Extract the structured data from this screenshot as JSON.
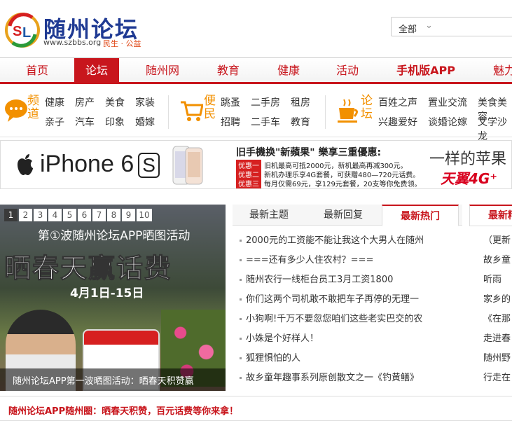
{
  "colors": {
    "brand_red": "#c8161d",
    "orange": "#f29000",
    "dark": "#333333"
  },
  "header": {
    "logo_title": "随州论坛",
    "logo_url": "www.szbbs.org",
    "logo_slogan": "民生 · 公益",
    "search_scope": "全部"
  },
  "nav": {
    "items": [
      "首页",
      "论坛",
      "随州网",
      "教育",
      "健康",
      "活动",
      "手机版APP",
      "魅力"
    ],
    "active": "论坛"
  },
  "channels": [
    {
      "tag": "频道",
      "icon": "chat-bubble-icon",
      "links": [
        [
          "健康",
          "房产",
          "美食",
          "家装"
        ],
        [
          "亲子",
          "汽车",
          "印象",
          "婚嫁"
        ]
      ]
    },
    {
      "tag": "便民",
      "icon": "shopping-cart-icon",
      "links": [
        [
          "跳蚤",
          "二手房",
          "租房"
        ],
        [
          "招聘",
          "二手车",
          "教育"
        ]
      ]
    },
    {
      "tag": "论坛",
      "icon": "coffee-cup-icon",
      "links": [
        [
          "百姓之声",
          "置业交流",
          "美食美容"
        ],
        [
          "兴趣爱好",
          "谈婚论嫁",
          "文学沙龙"
        ]
      ]
    }
  ],
  "banner": {
    "product": "iPhone 6",
    "product_s": "S",
    "promo_title": "旧手機换\"新蘋果\"  樂享三重優惠:",
    "promo_rows": [
      {
        "tag": "优惠一",
        "text": "旧机最高可抵2000元，新机最高再减300元。"
      },
      {
        "tag": "优惠二",
        "text": "新机办理乐享4G套餐，可获赠480—720元话费。"
      },
      {
        "tag": "优惠三",
        "text": "每月仅需69元，享129元套餐，20支等你免费领。"
      }
    ],
    "slogan": "一样的苹果",
    "brand": "天翼4G⁺"
  },
  "slideshow": {
    "numbers": [
      "1",
      "2",
      "3",
      "4",
      "5",
      "6",
      "7",
      "8",
      "9",
      "10"
    ],
    "active": "1",
    "heading": "第①波随州论坛APP晒图活动",
    "big_text": "晒春天赢话费",
    "date_text": "4月1日-15日",
    "caption": "随州论坛APP第一波晒图活动：晒春天积赞赢"
  },
  "tabs": {
    "labels": [
      "最新主题",
      "最新回复",
      "最新热门"
    ],
    "active": "最新热门",
    "news": [
      "2000元的工资能不能让我这个大男人在随州",
      "===还有多少人住农村？===",
      "随州农行一线柜台员工3月工资1800",
      "你们这两个司机敢不敢把车子再停的无理一",
      "小狗啊!千万不要忽您咱们这些老实巴交的农",
      "小姝是个好样人！",
      "狐狸惧怕的人",
      "故乡童年趣事系列原创散文之一《钓黄鳝》"
    ]
  },
  "right_panel": {
    "tab": "最新精华",
    "items": [
      "（更新",
      "故乡童",
      "听雨",
      "家乡的",
      "《在那",
      "走进春",
      "随州野",
      "行走在"
    ]
  },
  "bottom": {
    "text": "随州论坛APP随州圈：晒春天积赞，百元话费等你来拿！"
  }
}
